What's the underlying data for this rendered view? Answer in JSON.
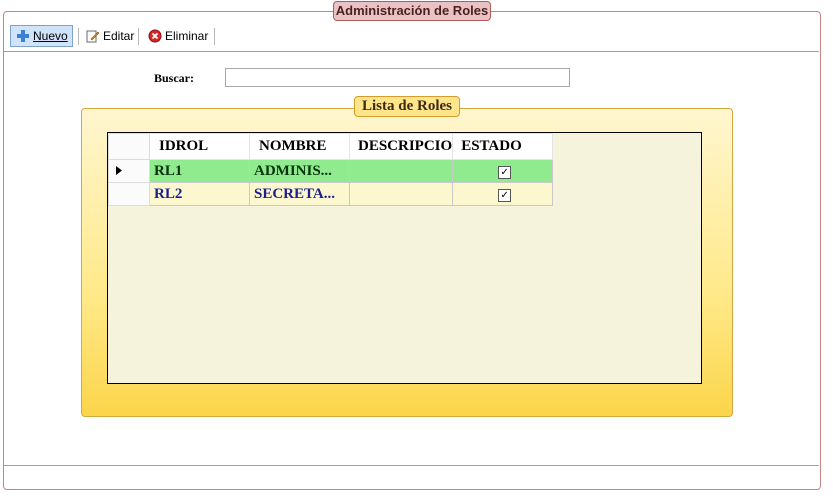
{
  "window": {
    "title": "Administración de Roles"
  },
  "toolbar": {
    "nuevo_label": "Nuevo",
    "editar_label": "Editar",
    "eliminar_label": "Eliminar",
    "icons": {
      "nuevo": "plus-icon",
      "editar": "edit-pencil-icon",
      "eliminar": "delete-circle-icon"
    }
  },
  "search": {
    "label": "Buscar:",
    "value": ""
  },
  "group": {
    "title": "Lista de Roles"
  },
  "grid": {
    "columns": [
      "IDROL",
      "NOMBRE",
      "DESCRIPCIO",
      "ESTADO"
    ],
    "rows": [
      {
        "idrol": "RL1",
        "nombre": "ADMINIS...",
        "descripcion": "",
        "estado": true,
        "selected": true
      },
      {
        "idrol": "RL2",
        "nombre": "SECRETA...",
        "descripcion": "",
        "estado": true,
        "selected": false
      }
    ]
  },
  "colors": {
    "selected_row": "#90ea8e",
    "alt_row": "#fdf7d0",
    "group_gold": "#fbd54a",
    "title_tab": "#e9c3c3"
  }
}
